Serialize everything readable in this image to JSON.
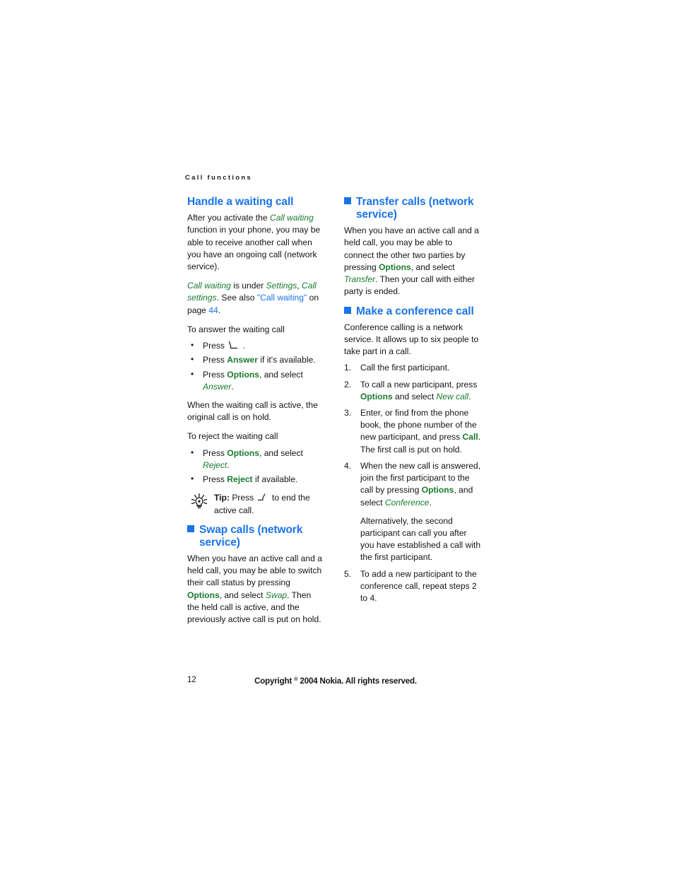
{
  "running_header": "Call functions",
  "left_column": {
    "heading_handle": "Handle a waiting call",
    "p_after_activate_1": "After you activate the ",
    "p_after_activate_call_waiting": "Call waiting",
    "p_after_activate_2": " function in your phone, you may be able to receive another call when you have an ongoing call (network service).",
    "p_under_1": "Call waiting",
    "p_under_2": " is under ",
    "p_under_settings": "Settings",
    "p_under_3": ", ",
    "p_under_callsettings": "Call settings",
    "p_under_4": ". See also ",
    "p_under_ref": "\"Call waiting\"",
    "p_under_5": " on page ",
    "p_under_page": "44",
    "p_under_6": ".",
    "p_to_answer": "To answer the waiting call",
    "bullet_answer_1_press": "Press ",
    "bullet_answer_1_after": " .",
    "bullet_answer_2_press": "Press ",
    "bullet_answer_2_key": "Answer",
    "bullet_answer_2_after": " if it's available.",
    "bullet_answer_3_press": "Press ",
    "bullet_answer_3_key": "Options",
    "bullet_answer_3_mid": ", and select ",
    "bullet_answer_3_item": "Answer",
    "bullet_answer_3_after": ".",
    "p_when_active": "When the waiting call is active, the original call is on hold.",
    "p_to_reject": "To reject the waiting call",
    "bullet_reject_1_press": "Press ",
    "bullet_reject_1_key": "Options",
    "bullet_reject_1_mid": ", and select ",
    "bullet_reject_1_item": "Reject",
    "bullet_reject_1_after": ".",
    "bullet_reject_2_press": "Press ",
    "bullet_reject_2_key": "Reject",
    "bullet_reject_2_after": " if available.",
    "tip_label": "Tip:",
    "tip_press": " Press ",
    "tip_after": " to end the active call.",
    "heading_swap": "Swap calls (network service)",
    "p_swap_1": "When you have an active call and a held call, you may be able to switch their call status by pressing ",
    "p_swap_options": "Options",
    "p_swap_2": ", and select ",
    "p_swap_item": "Swap",
    "p_swap_3": ". Then the held call is active, and the previously active call is put on hold."
  },
  "right_column": {
    "heading_transfer": "Transfer calls (network service)",
    "p_transfer_1": "When you have an active call and a held call, you may be able to connect the other two parties by pressing ",
    "p_transfer_options": "Options",
    "p_transfer_2": ", and select ",
    "p_transfer_item": "Transfer",
    "p_transfer_3": ". Then your call with either party is ended.",
    "heading_conference": "Make a conference call",
    "p_conference_intro": "Conference calling is a network service. It allows up to six people to take part in a call.",
    "step1": "Call the first participant.",
    "step2_1": "To call a new participant, press ",
    "step2_options": "Options",
    "step2_2": " and select ",
    "step2_item": "New call",
    "step2_3": ".",
    "step3_1": "Enter, or find from the phone book, the phone number of the new participant, and press ",
    "step3_call": "Call",
    "step3_2": ". The first call is put on hold.",
    "step4_1": "When the new call is answered, join the first participant to the call by pressing ",
    "step4_options": "Options",
    "step4_2": ", and select ",
    "step4_item": "Conference",
    "step4_3": ".",
    "step4_alt": "Alternatively, the second participant can call you after you have established a call with the first participant.",
    "step5": "To add a new participant to the conference call, repeat steps 2 to 4."
  },
  "footer": {
    "page_number": "12",
    "copyright_prefix": "Copyright ",
    "copyright_symbol": "®",
    "copyright_rest": " 2004 Nokia. All rights reserved."
  },
  "colors": {
    "heading_blue": "#1a74e8",
    "softkey_green": "#1a7a2e",
    "link_blue": "#1a74e8",
    "body_text": "#141414"
  },
  "icons": {
    "tip": "lightbulb-icon",
    "send_key": "send-call-key-icon",
    "end_key": "end-call-key-icon",
    "heading_marker": "blue-square-bullet-icon"
  }
}
